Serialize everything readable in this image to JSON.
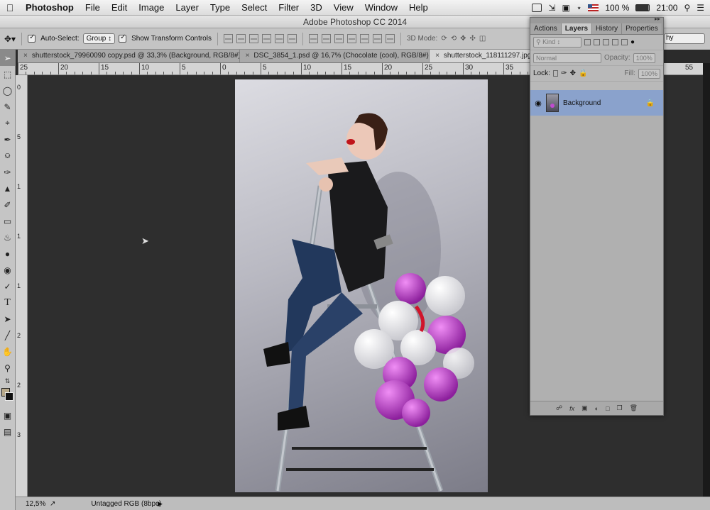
{
  "menubar": {
    "app_name": "Photoshop",
    "items": [
      "File",
      "Edit",
      "Image",
      "Layer",
      "Type",
      "Select",
      "Filter",
      "3D",
      "View",
      "Window",
      "Help"
    ],
    "battery": "100 %",
    "clock": "21:00"
  },
  "window_title": "Adobe Photoshop CC 2014",
  "options": {
    "auto_select_label": "Auto-Select:",
    "auto_select_value": "Group",
    "show_transform_label": "Show Transform Controls",
    "mode_3d_label": "3D Mode:",
    "workspace_fragment": "hy"
  },
  "tabs": [
    {
      "label": "shutterstock_79960090 copy.psd @ 33,3% (Background, RGB/8#) *"
    },
    {
      "label": "DSC_3854_1.psd @ 16,7% (Chocolate (cool), RGB/8#) *"
    },
    {
      "label": "shutterstock_118111297.jpg"
    }
  ],
  "ruler_top": [
    "25",
    "20",
    "15",
    "10",
    "5",
    "0",
    "5",
    "10",
    "15",
    "20",
    "25",
    "30",
    "35"
  ],
  "ruler_top_right": "55",
  "ruler_left": [
    "0",
    "5",
    "1",
    "1",
    "1",
    "2",
    "2",
    "3"
  ],
  "status": {
    "zoom": "12,5%",
    "doc_info": "Untagged RGB (8bpc)"
  },
  "panel": {
    "tabs": [
      "Actions",
      "Layers",
      "History",
      "Properties"
    ],
    "active_tab": "Layers",
    "filter_kind": "Kind",
    "blend_mode": "Normal",
    "opacity_label": "Opacity:",
    "opacity_value": "100%",
    "lock_label": "Lock:",
    "fill_label": "Fill:",
    "fill_value": "100%",
    "layer_name": "Background"
  }
}
